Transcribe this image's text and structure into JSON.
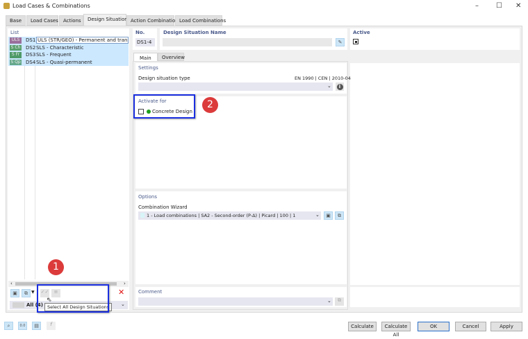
{
  "window": {
    "title": "Load Cases & Combinations"
  },
  "tabs": [
    "Base",
    "Load Cases",
    "Actions",
    "Design Situations",
    "Action Combinations",
    "Load Combinations"
  ],
  "list": {
    "header": "List",
    "rows": [
      {
        "badge": "ULS",
        "color": "#9b6f9b",
        "no": "DS1",
        "name": "ULS (STR/GEO) - Permanent and transient - E"
      },
      {
        "badge": "S Ch",
        "color": "#5aa06e",
        "no": "DS2",
        "name": "SLS - Characteristic"
      },
      {
        "badge": "S Fr",
        "color": "#4e9a68",
        "no": "DS3",
        "name": "SLS - Frequent"
      },
      {
        "badge": "S Qp",
        "color": "#64a88a",
        "no": "DS4",
        "name": "SLS - Quasi-permanent"
      }
    ],
    "filter": "All (4)",
    "tooltip": "Select All Design Situations"
  },
  "header": {
    "no_label": "No.",
    "no_value": "DS1-4",
    "name_label": "Design Situation Name",
    "active_label": "Active"
  },
  "subtabs": [
    "Main",
    "Overview"
  ],
  "settings": {
    "title": "Settings",
    "type_label": "Design situation type",
    "standard": "EN 1990 | CEN | 2010-04"
  },
  "activate": {
    "title": "Activate for",
    "item": "Concrete Design"
  },
  "options": {
    "title": "Options",
    "wizard_label": "Combination Wizard",
    "wizard_value": "1 - Load combinations | SA2 - Second-order (P-Δ) | Picard | 100 | 1"
  },
  "comment": {
    "title": "Comment"
  },
  "callouts": [
    "1",
    "2"
  ],
  "buttons": {
    "calculate": "Calculate",
    "calculate_all": "Calculate All",
    "ok": "OK",
    "cancel": "Cancel",
    "apply": "Apply"
  }
}
